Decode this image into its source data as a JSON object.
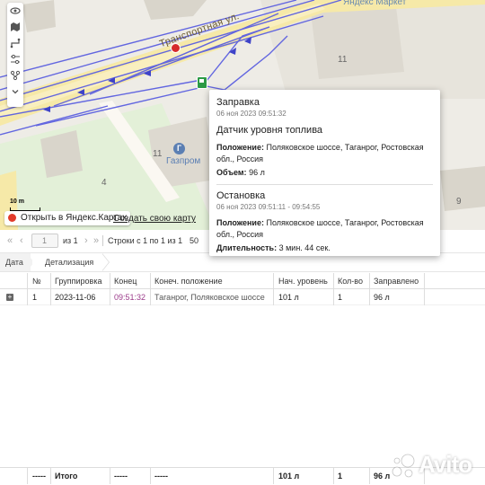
{
  "map": {
    "street_label": "Транспортная ул.",
    "market_label": "Яндекс Маркет",
    "gazprom_label": "Газпром",
    "house_numbers": [
      "11",
      "11",
      "4",
      "9"
    ],
    "scale_label": "10 m",
    "open_in_yandex": "Открыть в Яндекс.Картах",
    "create_map": "Создать свою карту",
    "toolbar_icons": [
      "eye-icon",
      "map-layers-icon",
      "route-icon",
      "settings-sliders-icon",
      "nodes-icon",
      "chevron-down-icon"
    ],
    "track_color": "#5b5fe0",
    "road_color": "#f6e9a8"
  },
  "popup": {
    "events": [
      {
        "title": "Заправка",
        "time": "06 ноя 2023 09:51:32",
        "sensor": "Датчик уровня топлива",
        "position_label": "Положение:",
        "position_value": "Поляковское шоссе, Таганрог, Ростовская обл., Россия",
        "extra_label": "Объем:",
        "extra_value": "96 л"
      },
      {
        "title": "Остановка",
        "time": "06 ноя 2023 09:51:11 - 09:54:55",
        "position_label": "Положение:",
        "position_value": "Поляковское шоссе, Таганрог, Ростовская обл., Россия",
        "extra_label": "Длительность:",
        "extra_value": "3 мин. 44 сек."
      }
    ]
  },
  "pager": {
    "first": "«",
    "prev": "‹",
    "page": "1",
    "of_label": "из 1",
    "next": "›",
    "last": "»",
    "rows_label": "Строки с 1 по 1 из 1",
    "page_size": "50"
  },
  "grouping": {
    "chips": [
      "Дата",
      "Детализация"
    ]
  },
  "table": {
    "headers": {
      "no": "№",
      "grp": "Группировка",
      "end": "Конец",
      "pos": "Конеч. положение",
      "lvl": "Нач. уровень",
      "cnt": "Кол-во",
      "fill": "Заправлено"
    },
    "rows": [
      {
        "expand": "+",
        "no": "1",
        "grp": "2023-11-06",
        "end": "09:51:32",
        "pos": "Таганрог, Поляковское шоссе",
        "lvl": "101 л",
        "cnt": "1",
        "fill": "96 л"
      }
    ],
    "footer": {
      "no": "-----",
      "grp": "Итого",
      "end": "-----",
      "pos": "-----",
      "lvl": "101 л",
      "cnt": "1",
      "fill": "96 л"
    }
  },
  "watermark": "Avito"
}
